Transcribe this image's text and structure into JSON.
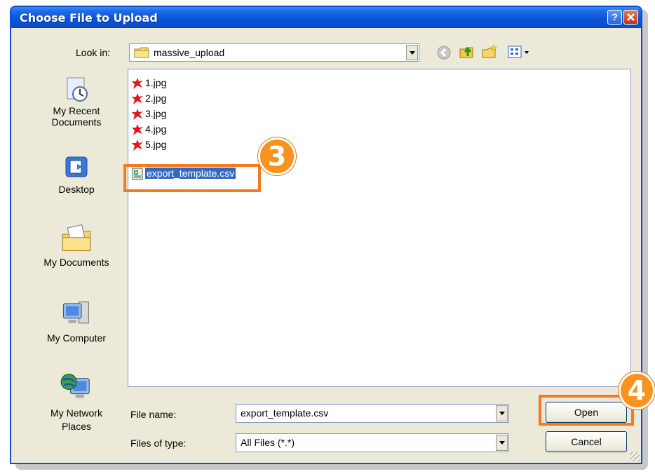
{
  "dialog": {
    "title": "Choose File to Upload",
    "help_label": "?",
    "close_label": "x"
  },
  "look_in": {
    "label": "Look in:",
    "value": "massive_upload"
  },
  "toolbar": {
    "icons": [
      "back-icon",
      "up-folder-icon",
      "new-folder-icon",
      "view-menu-icon"
    ]
  },
  "places": [
    {
      "label": "My Recent Documents",
      "icon": "recent-documents-icon"
    },
    {
      "label": "Desktop",
      "icon": "desktop-icon"
    },
    {
      "label": "My Documents",
      "icon": "my-documents-icon"
    },
    {
      "label": "My Computer",
      "icon": "my-computer-icon"
    },
    {
      "label": "My Network Places",
      "icon": "network-places-icon"
    }
  ],
  "files": [
    {
      "name": "1.jpg",
      "icon": "image-file-icon"
    },
    {
      "name": "2.jpg",
      "icon": "image-file-icon"
    },
    {
      "name": "3.jpg",
      "icon": "image-file-icon"
    },
    {
      "name": "4.jpg",
      "icon": "image-file-icon"
    },
    {
      "name": "5.jpg",
      "icon": "image-file-icon"
    },
    {
      "name": "export_template.csv",
      "icon": "csv-file-icon",
      "selected": true
    }
  ],
  "file_name": {
    "label": "File name:",
    "value": "export_template.csv"
  },
  "file_type": {
    "label": "Files of type:",
    "value": "All Files (*.*)"
  },
  "buttons": {
    "open": "Open",
    "cancel": "Cancel"
  },
  "annotations": {
    "step_select": "3",
    "step_open": "4",
    "highlight_color": "#f47a20",
    "badge_color": "#f7931e"
  },
  "colors": {
    "titlebar": "#0a55db",
    "dialog_bg": "#ece9d8",
    "selection": "#316ac5"
  }
}
